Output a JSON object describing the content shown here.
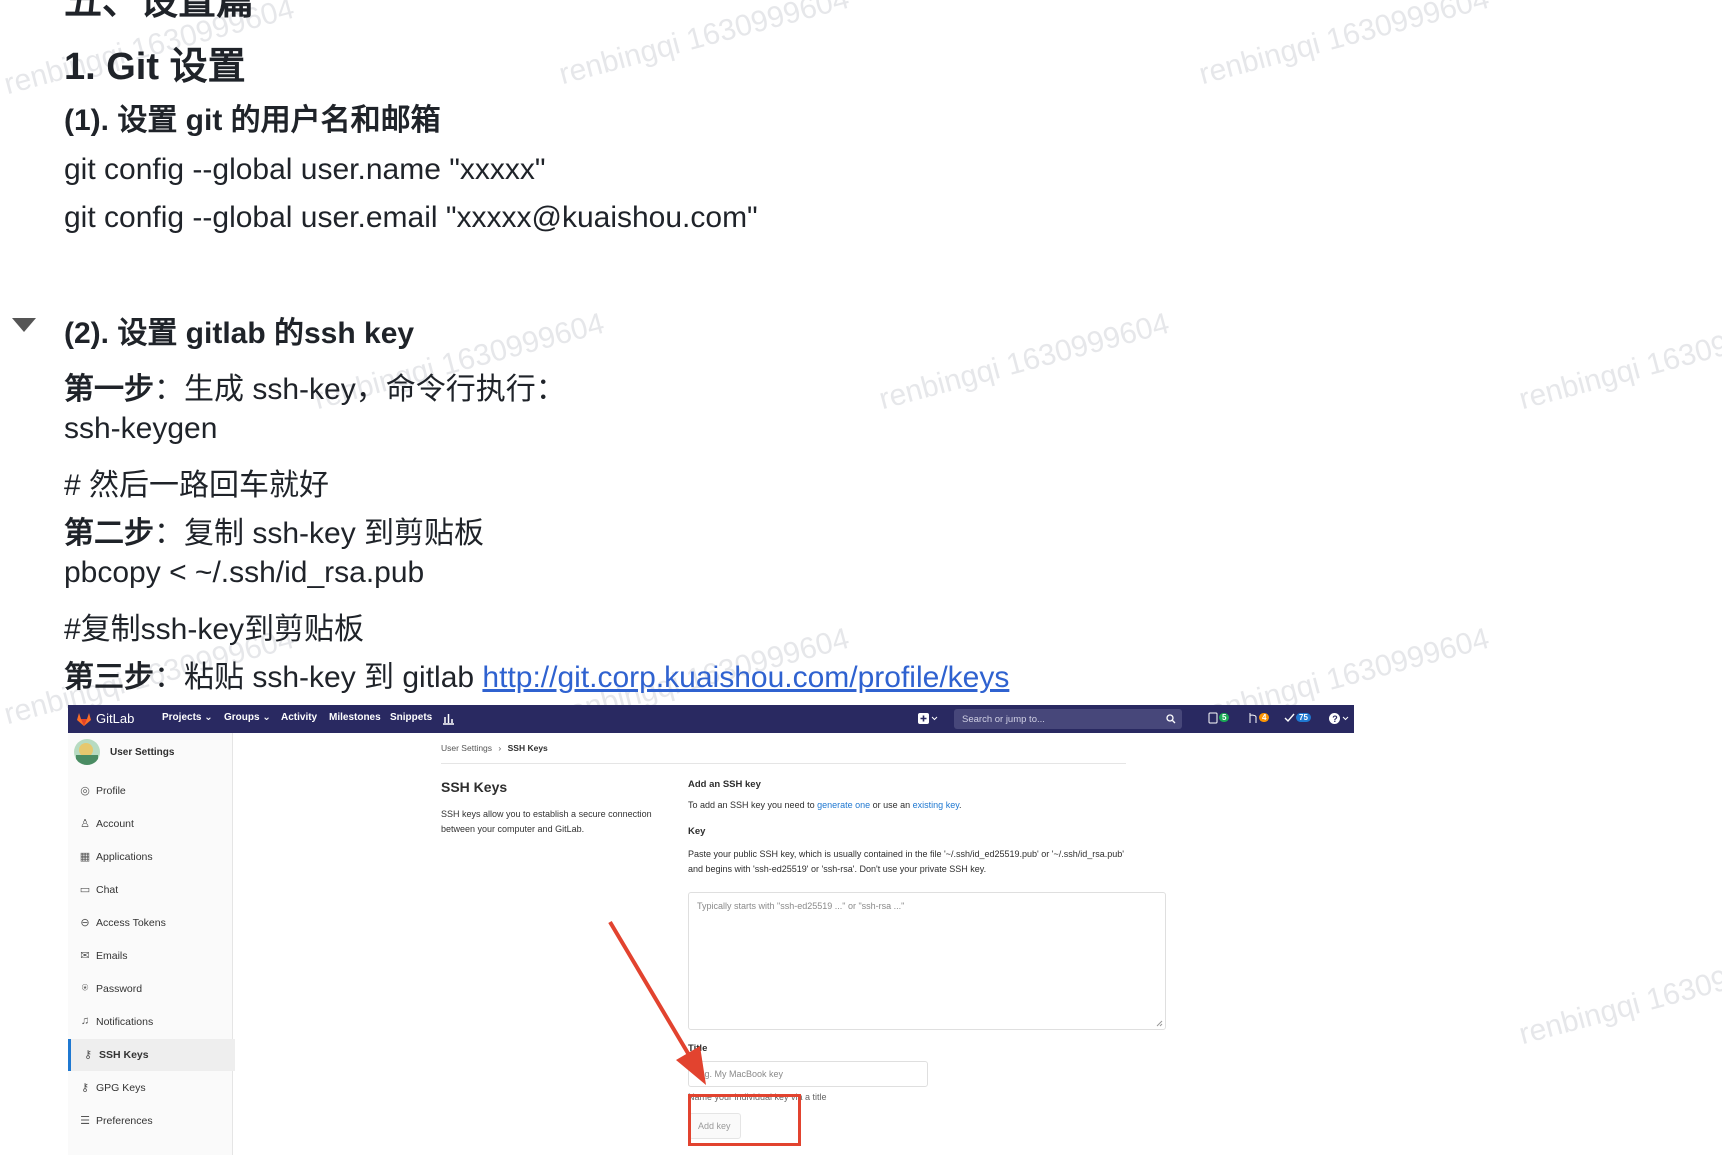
{
  "doc": {
    "section_heading": "五、设置篇",
    "h1": "1. Git 设置",
    "sub1": "(1). 设置 git 的用户名和邮箱",
    "cmd_name": "git config --global user.name \"xxxxx\"",
    "cmd_email": "git config --global user.email \"xxxxx@kuaishou.com\"",
    "sub2": "(2). 设置 gitlab 的ssh key",
    "step1_label": "第一步",
    "step1_text": "：生成 ssh-key，命令行执行：",
    "cmd_keygen": "ssh-keygen",
    "comment1": "# 然后一路回车就好",
    "step2_label": "第二步",
    "step2_text": "：复制 ssh-key 到剪贴板",
    "cmd_pbcopy": "pbcopy < ~/.ssh/id_rsa.pub",
    "comment2": "#复制ssh-key到剪贴板",
    "step3_label": "第三步",
    "step3_text": "：粘贴 ssh-key 到 gitlab ",
    "step3_link": "http://git.corp.kuaishou.com/profile/keys"
  },
  "watermark": "renbingqi 1630999604",
  "gitlab": {
    "brand": "GitLab",
    "nav": [
      "Projects ⌄",
      "Groups ⌄",
      "Activity",
      "Milestones",
      "Snippets"
    ],
    "search_placeholder": "Search or jump to...",
    "badges": [
      "5",
      "4",
      "75"
    ],
    "sidebar_title": "User Settings",
    "sidebar_items": [
      {
        "icon": "profile-icon",
        "label": "Profile"
      },
      {
        "icon": "account-icon",
        "label": "Account"
      },
      {
        "icon": "applications-icon",
        "label": "Applications"
      },
      {
        "icon": "chat-icon",
        "label": "Chat"
      },
      {
        "icon": "token-icon",
        "label": "Access Tokens"
      },
      {
        "icon": "email-icon",
        "label": "Emails"
      },
      {
        "icon": "lock-icon",
        "label": "Password"
      },
      {
        "icon": "bell-icon",
        "label": "Notifications"
      },
      {
        "icon": "key-icon",
        "label": "SSH Keys"
      },
      {
        "icon": "key-icon",
        "label": "GPG Keys"
      },
      {
        "icon": "preferences-icon",
        "label": "Preferences"
      }
    ],
    "active_item": "SSH Keys",
    "breadcrumb_root": "User Settings",
    "breadcrumb_current": "SSH Keys",
    "page_title": "SSH Keys",
    "page_desc": "SSH keys allow you to establish a secure connection between your computer and GitLab.",
    "add_heading": "Add an SSH key",
    "add_text_pre": "To add an SSH key you need to ",
    "add_link1": "generate one",
    "add_text_mid": " or use an ",
    "add_link2": "existing key",
    "add_text_end": ".",
    "key_label": "Key",
    "key_help": "Paste your public SSH key, which is usually contained in the file '~/.ssh/id_ed25519.pub' or '~/.ssh/id_rsa.pub' and begins with 'ssh-ed25519' or 'ssh-rsa'. Don't use your private SSH key.",
    "key_placeholder": "Typically starts with \"ssh-ed25519 ...\" or \"ssh-rsa ...\"",
    "title_label": "Title",
    "title_placeholder": "e.g. My MacBook key",
    "title_help": "Name your individual key via a title",
    "add_button": "Add key"
  },
  "colors": {
    "accent": "#1f78d1",
    "nav": "#292961",
    "annotation": "#e2432f"
  }
}
